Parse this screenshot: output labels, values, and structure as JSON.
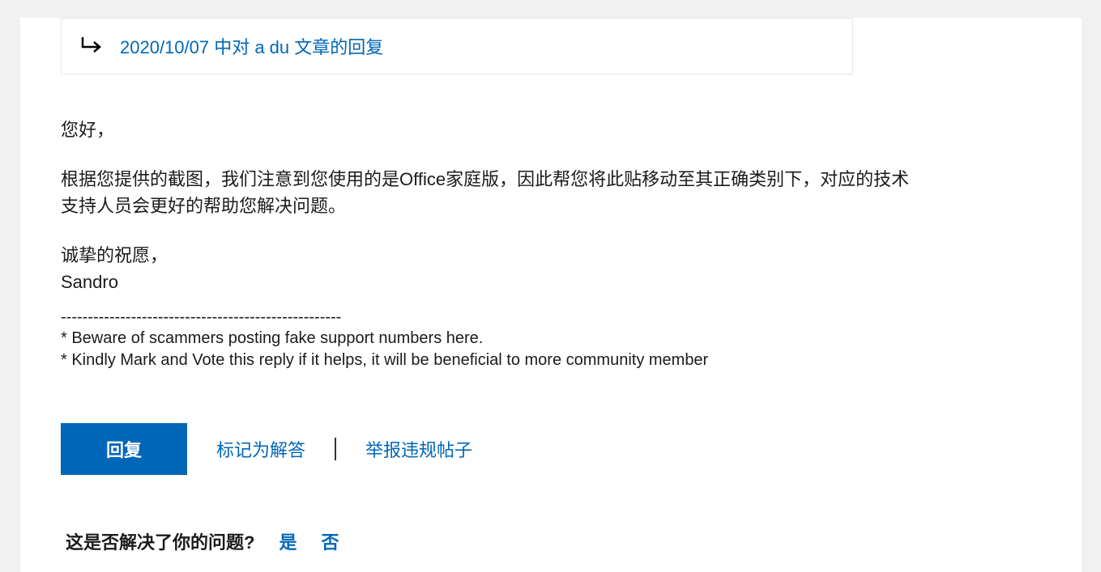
{
  "reply_header": {
    "link_text": "2020/10/07 中对 a du 文章的回复"
  },
  "message": {
    "greeting": "您好，",
    "body": "根据您提供的截图，我们注意到您使用的是Office家庭版，因此帮您将此贴移动至其正确类别下，对应的技术支持人员会更好的帮助您解决问题。",
    "closing": "诚挚的祝愿，",
    "signature": "Sandro",
    "dashes": "----------------------------------------------------",
    "note1": "* Beware of scammers posting fake support numbers here.",
    "note2": "* Kindly Mark and Vote this reply if it helps, it will be beneficial to more community member"
  },
  "actions": {
    "reply": "回复",
    "mark_answer": "标记为解答",
    "report": "举报违规帖子"
  },
  "feedback": {
    "question": "这是否解决了你的问题?",
    "yes": "是",
    "no": "否"
  }
}
